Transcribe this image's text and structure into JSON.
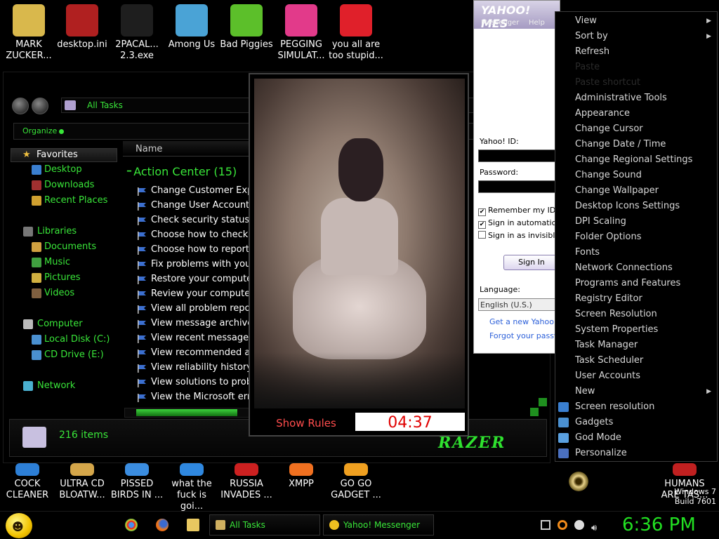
{
  "desktop_top_icons": [
    {
      "label": "MARK\nZUCKER...",
      "icon": "folder-icon",
      "color": "#d9b84c"
    },
    {
      "label": "desktop.ini",
      "icon": "gear-file-icon",
      "color": "#b02020"
    },
    {
      "label": "2PACAL...\n2.3.exe",
      "icon": "console-icon",
      "color": "#1e1e1e"
    },
    {
      "label": "Among Us",
      "icon": "app-icon",
      "color": "#4aa3d6"
    },
    {
      "label": "Bad Piggies",
      "icon": "piggy-icon",
      "color": "#5cbf2a"
    },
    {
      "label": "PEGGING\nSIMULAT...",
      "icon": "p-logo-icon",
      "color": "#e23a8a"
    },
    {
      "label": "you all are\ntoo stupid...",
      "icon": "dev-cpp-icon",
      "color": "#e0202a"
    }
  ],
  "desktop_bottom_icons": [
    {
      "label": "COCK\nCLEANER",
      "color": "#2d7fd6"
    },
    {
      "label": "ULTRA CD\nBLOATW...",
      "color": "#d4a64a"
    },
    {
      "label": "PISSED\nBIRDS IN ...",
      "color": "#3b8de0"
    },
    {
      "label": "what the\nfuck is goi...",
      "color": "#2f88e0"
    },
    {
      "label": "RUSSIA\nINVADES ...",
      "color": "#cc2020"
    },
    {
      "label": "XMPP",
      "color": "#f07020"
    },
    {
      "label": "GO GO\nGADGET ...",
      "color": "#f0a020"
    },
    {
      "label": "HUMANS\nARE TAS...",
      "color": "#c02020"
    }
  ],
  "explorer": {
    "address": "All Tasks",
    "toolbar_organize": "Organize",
    "column_name": "Name",
    "group_title": "Action Center (15)",
    "nav": [
      {
        "label": "Favorites",
        "type": "header",
        "color": "#f0c040"
      },
      {
        "label": "Desktop",
        "type": "item",
        "color": "#3a7fd0"
      },
      {
        "label": "Downloads",
        "type": "item",
        "color": "#a03030"
      },
      {
        "label": "Recent Places",
        "type": "item",
        "color": "#d0a030"
      },
      {
        "label": "",
        "type": "gap"
      },
      {
        "label": "Libraries",
        "type": "section",
        "color": "#777"
      },
      {
        "label": "Documents",
        "type": "item",
        "color": "#d0a040"
      },
      {
        "label": "Music",
        "type": "item",
        "color": "#40a040"
      },
      {
        "label": "Pictures",
        "type": "item",
        "color": "#d0b040"
      },
      {
        "label": "Videos",
        "type": "item",
        "color": "#806040"
      },
      {
        "label": "",
        "type": "gap"
      },
      {
        "label": "Computer",
        "type": "section",
        "color": "#bbb"
      },
      {
        "label": "Local Disk (C:)",
        "type": "item",
        "color": "#4a90d0"
      },
      {
        "label": "CD Drive (E:)",
        "type": "item",
        "color": "#4a90d0"
      },
      {
        "label": "",
        "type": "gap"
      },
      {
        "label": "Network",
        "type": "section",
        "color": "#4ab0d0"
      }
    ],
    "tasks": [
      "Change Customer Experience",
      "Change User Account Control",
      "Check security status",
      "Choose how to check for solutions",
      "Choose how to report problems",
      "Fix problems with your computer",
      "Restore your computer to an earlier time",
      "Review your computer's status",
      "View all problem reports",
      "View message archive",
      "View recent messages about your computer",
      "View recommended actions",
      "View reliability history",
      "View solutions to problems",
      "View the Microsoft error reporting"
    ],
    "item_count": "216 items",
    "brand": "RAZER"
  },
  "popup": {
    "show_rules_label": "Show Rules",
    "timer": "04:37"
  },
  "yahoo": {
    "logo": "YAHOO! MES",
    "tab_messenger": "Messenger",
    "tab_help": "Help",
    "id_label": "Yahoo! ID:",
    "password_label": "Password:",
    "remember": "Remember my ID &",
    "sign_in_auto": "Sign in automatically",
    "sign_in_invisible": "Sign in as invisible t",
    "sign_in_button": "Sign In",
    "language_label": "Language:",
    "language_value": "English (U.S.)",
    "link_new": "Get a new Yahoo! I",
    "link_forgot": "Forgot your passw"
  },
  "context_menu": [
    {
      "label": "View",
      "submenu": true
    },
    {
      "label": "Sort by",
      "submenu": true
    },
    {
      "label": "Refresh"
    },
    {
      "label": "Paste",
      "disabled": true
    },
    {
      "label": "Paste shortcut",
      "disabled": true
    },
    {
      "label": "Administrative Tools"
    },
    {
      "label": "Appearance"
    },
    {
      "label": "Change Cursor"
    },
    {
      "label": "Change Date / Time"
    },
    {
      "label": "Change Regional Settings"
    },
    {
      "label": "Change Sound"
    },
    {
      "label": "Change Wallpaper"
    },
    {
      "label": "Desktop Icons Settings"
    },
    {
      "label": "DPI Scaling"
    },
    {
      "label": "Folder Options"
    },
    {
      "label": "Fonts"
    },
    {
      "label": "Network Connections"
    },
    {
      "label": "Programs and Features"
    },
    {
      "label": "Registry Editor"
    },
    {
      "label": "Screen Resolution"
    },
    {
      "label": "System Properties"
    },
    {
      "label": "Task Manager"
    },
    {
      "label": "Task Scheduler"
    },
    {
      "label": "User Accounts"
    },
    {
      "label": "New",
      "submenu": true
    },
    {
      "label": "Screen resolution",
      "icon": "display-icon",
      "color": "#3a7fd0"
    },
    {
      "label": "Gadgets",
      "icon": "gadgets-icon",
      "color": "#4a90d0"
    },
    {
      "label": "God Mode",
      "icon": "control-panel-icon",
      "color": "#5aa0e0"
    },
    {
      "label": "Personalize",
      "icon": "personalize-icon",
      "color": "#4a70c0"
    }
  ],
  "taskbar": {
    "buttons": [
      {
        "label": "All Tasks",
        "icon": "folder-icon",
        "color": "#d0b060"
      },
      {
        "label": "Yahoo! Messenger",
        "icon": "smiley-icon",
        "color": "#f0c020"
      }
    ],
    "clock": "6:36 PM",
    "windows_version_line1": "Windows 7",
    "windows_version_line2": "Build 7601"
  }
}
